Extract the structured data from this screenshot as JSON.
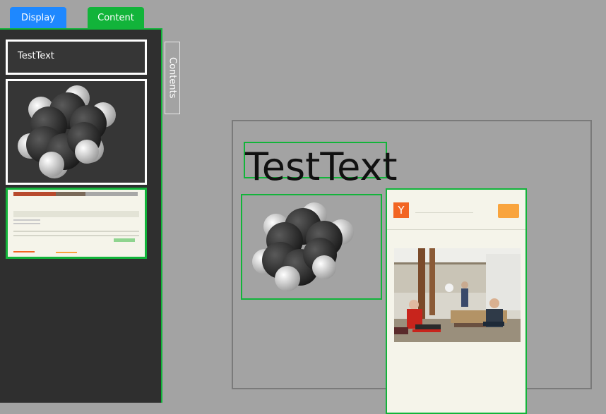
{
  "tabs": {
    "display": "Display",
    "content": "Content"
  },
  "sidebar": {
    "text_item": "TestText"
  },
  "side_tab": {
    "label": "Contents"
  },
  "canvas": {
    "text": "TestText",
    "page_logo": "Y"
  },
  "colors": {
    "accent_green": "#12b43a",
    "accent_blue": "#1e88ff",
    "logo_orange": "#f26522",
    "button_orange": "#f9a43d"
  }
}
